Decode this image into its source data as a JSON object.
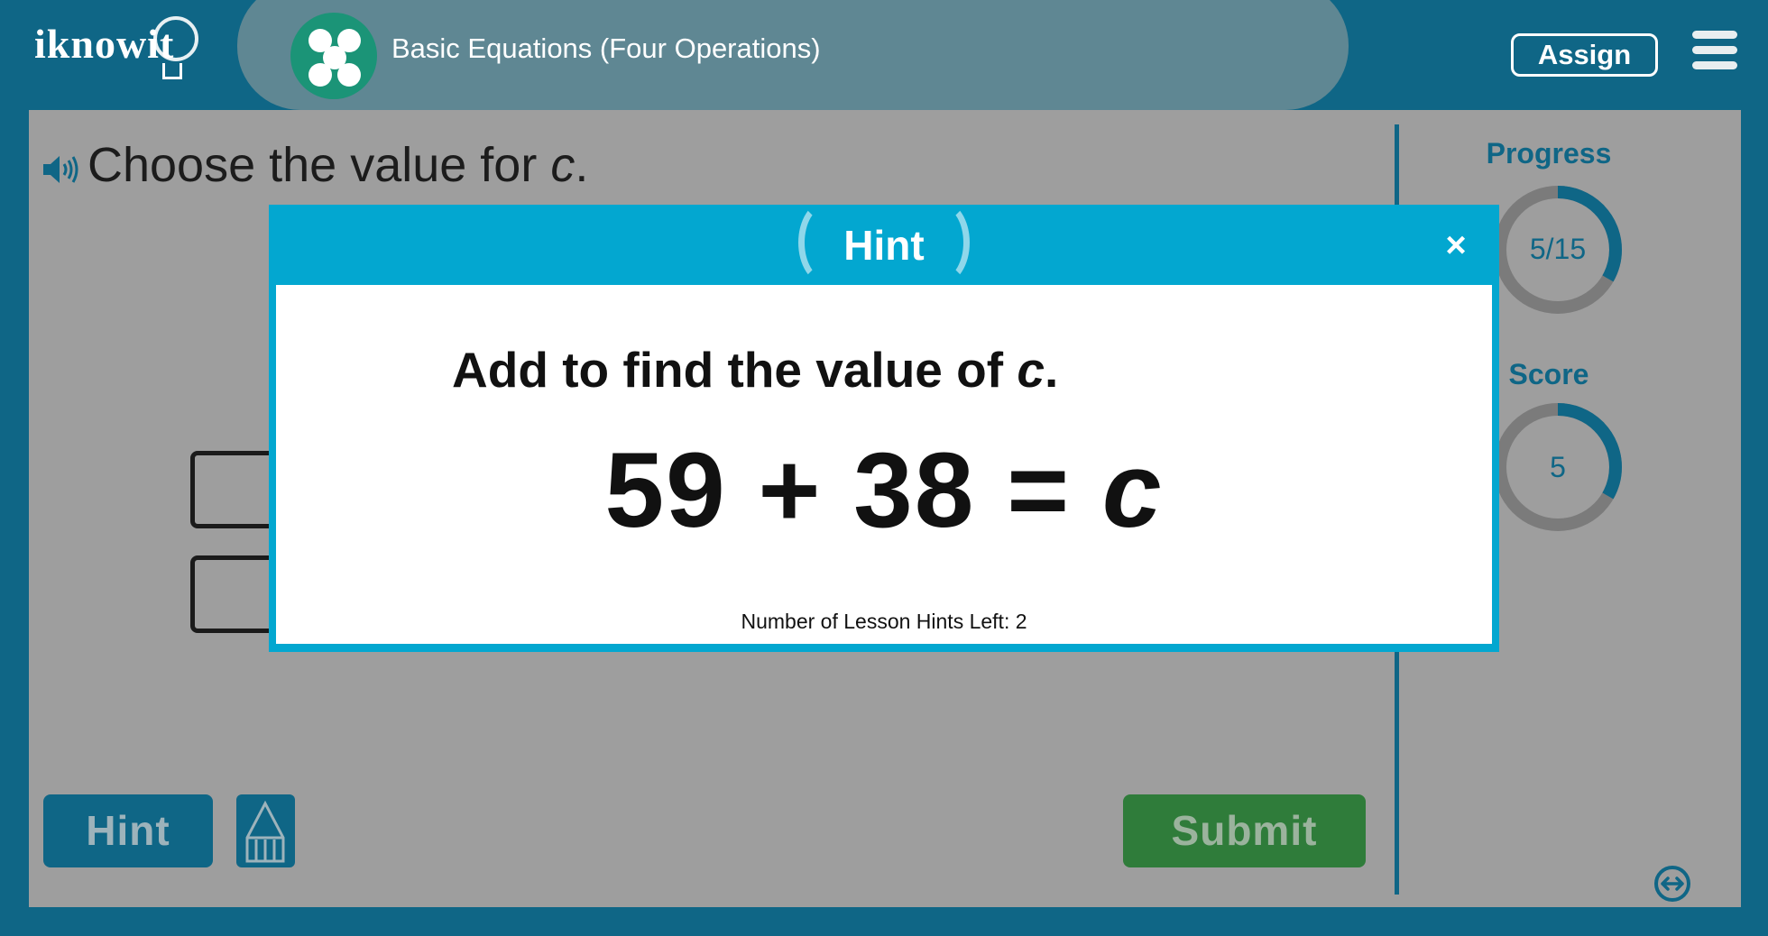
{
  "header": {
    "logo_text": "iknowit",
    "lesson_title": "Basic Equations (Four Operations)",
    "assign_label": "Assign",
    "menu_icon": "hamburger-menu-icon"
  },
  "question": {
    "prefix": "Choose the value for ",
    "variable": "c",
    "suffix": "."
  },
  "sidebar": {
    "progress_label": "Progress",
    "progress_value": "5/15",
    "progress_fraction": 0.333,
    "score_label": "Score",
    "score_value": "5",
    "score_fraction": 0.333
  },
  "footer": {
    "hint_label": "Hint",
    "submit_label": "Submit",
    "calculator_icon": "pencil-ruler-icon",
    "expand_icon": "expand-horizontal-icon"
  },
  "modal": {
    "title": "Hint",
    "close_symbol": "×",
    "instruction_prefix": "Add to find the value of ",
    "instruction_variable": "c",
    "instruction_suffix": ".",
    "equation_left": "59 + 38 = ",
    "equation_variable": "c",
    "hints_left": "Number of Lesson Hints Left: 2"
  },
  "colors": {
    "frame": "#0f6686",
    "modal_accent": "#03a7d0",
    "submit_green": "#2f7c3a",
    "overlay_gray": "#9e9e9e"
  }
}
